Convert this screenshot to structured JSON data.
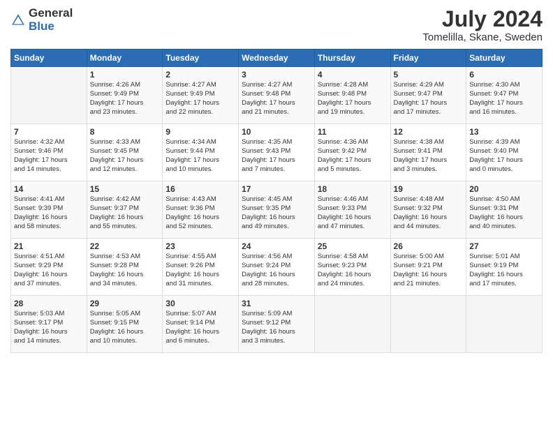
{
  "logo": {
    "general": "General",
    "blue": "Blue"
  },
  "title": {
    "month_year": "July 2024",
    "location": "Tomelilla, Skane, Sweden"
  },
  "header_days": [
    "Sunday",
    "Monday",
    "Tuesday",
    "Wednesday",
    "Thursday",
    "Friday",
    "Saturday"
  ],
  "weeks": [
    [
      {
        "day": "",
        "content": ""
      },
      {
        "day": "1",
        "content": "Sunrise: 4:26 AM\nSunset: 9:49 PM\nDaylight: 17 hours\nand 23 minutes."
      },
      {
        "day": "2",
        "content": "Sunrise: 4:27 AM\nSunset: 9:49 PM\nDaylight: 17 hours\nand 22 minutes."
      },
      {
        "day": "3",
        "content": "Sunrise: 4:27 AM\nSunset: 9:48 PM\nDaylight: 17 hours\nand 21 minutes."
      },
      {
        "day": "4",
        "content": "Sunrise: 4:28 AM\nSunset: 9:48 PM\nDaylight: 17 hours\nand 19 minutes."
      },
      {
        "day": "5",
        "content": "Sunrise: 4:29 AM\nSunset: 9:47 PM\nDaylight: 17 hours\nand 17 minutes."
      },
      {
        "day": "6",
        "content": "Sunrise: 4:30 AM\nSunset: 9:47 PM\nDaylight: 17 hours\nand 16 minutes."
      }
    ],
    [
      {
        "day": "7",
        "content": "Sunrise: 4:32 AM\nSunset: 9:46 PM\nDaylight: 17 hours\nand 14 minutes."
      },
      {
        "day": "8",
        "content": "Sunrise: 4:33 AM\nSunset: 9:45 PM\nDaylight: 17 hours\nand 12 minutes."
      },
      {
        "day": "9",
        "content": "Sunrise: 4:34 AM\nSunset: 9:44 PM\nDaylight: 17 hours\nand 10 minutes."
      },
      {
        "day": "10",
        "content": "Sunrise: 4:35 AM\nSunset: 9:43 PM\nDaylight: 17 hours\nand 7 minutes."
      },
      {
        "day": "11",
        "content": "Sunrise: 4:36 AM\nSunset: 9:42 PM\nDaylight: 17 hours\nand 5 minutes."
      },
      {
        "day": "12",
        "content": "Sunrise: 4:38 AM\nSunset: 9:41 PM\nDaylight: 17 hours\nand 3 minutes."
      },
      {
        "day": "13",
        "content": "Sunrise: 4:39 AM\nSunset: 9:40 PM\nDaylight: 17 hours\nand 0 minutes."
      }
    ],
    [
      {
        "day": "14",
        "content": "Sunrise: 4:41 AM\nSunset: 9:39 PM\nDaylight: 16 hours\nand 58 minutes."
      },
      {
        "day": "15",
        "content": "Sunrise: 4:42 AM\nSunset: 9:37 PM\nDaylight: 16 hours\nand 55 minutes."
      },
      {
        "day": "16",
        "content": "Sunrise: 4:43 AM\nSunset: 9:36 PM\nDaylight: 16 hours\nand 52 minutes."
      },
      {
        "day": "17",
        "content": "Sunrise: 4:45 AM\nSunset: 9:35 PM\nDaylight: 16 hours\nand 49 minutes."
      },
      {
        "day": "18",
        "content": "Sunrise: 4:46 AM\nSunset: 9:33 PM\nDaylight: 16 hours\nand 47 minutes."
      },
      {
        "day": "19",
        "content": "Sunrise: 4:48 AM\nSunset: 9:32 PM\nDaylight: 16 hours\nand 44 minutes."
      },
      {
        "day": "20",
        "content": "Sunrise: 4:50 AM\nSunset: 9:31 PM\nDaylight: 16 hours\nand 40 minutes."
      }
    ],
    [
      {
        "day": "21",
        "content": "Sunrise: 4:51 AM\nSunset: 9:29 PM\nDaylight: 16 hours\nand 37 minutes."
      },
      {
        "day": "22",
        "content": "Sunrise: 4:53 AM\nSunset: 9:28 PM\nDaylight: 16 hours\nand 34 minutes."
      },
      {
        "day": "23",
        "content": "Sunrise: 4:55 AM\nSunset: 9:26 PM\nDaylight: 16 hours\nand 31 minutes."
      },
      {
        "day": "24",
        "content": "Sunrise: 4:56 AM\nSunset: 9:24 PM\nDaylight: 16 hours\nand 28 minutes."
      },
      {
        "day": "25",
        "content": "Sunrise: 4:58 AM\nSunset: 9:23 PM\nDaylight: 16 hours\nand 24 minutes."
      },
      {
        "day": "26",
        "content": "Sunrise: 5:00 AM\nSunset: 9:21 PM\nDaylight: 16 hours\nand 21 minutes."
      },
      {
        "day": "27",
        "content": "Sunrise: 5:01 AM\nSunset: 9:19 PM\nDaylight: 16 hours\nand 17 minutes."
      }
    ],
    [
      {
        "day": "28",
        "content": "Sunrise: 5:03 AM\nSunset: 9:17 PM\nDaylight: 16 hours\nand 14 minutes."
      },
      {
        "day": "29",
        "content": "Sunrise: 5:05 AM\nSunset: 9:15 PM\nDaylight: 16 hours\nand 10 minutes."
      },
      {
        "day": "30",
        "content": "Sunrise: 5:07 AM\nSunset: 9:14 PM\nDaylight: 16 hours\nand 6 minutes."
      },
      {
        "day": "31",
        "content": "Sunrise: 5:09 AM\nSunset: 9:12 PM\nDaylight: 16 hours\nand 3 minutes."
      },
      {
        "day": "",
        "content": ""
      },
      {
        "day": "",
        "content": ""
      },
      {
        "day": "",
        "content": ""
      }
    ]
  ]
}
